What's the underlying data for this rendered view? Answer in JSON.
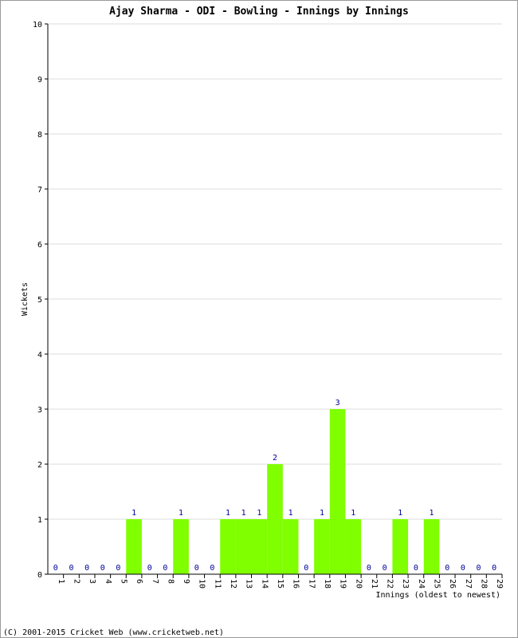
{
  "chart_data": {
    "type": "bar",
    "title": "Ajay Sharma - ODI - Bowling - Innings by Innings",
    "xlabel": "Innings (oldest to newest)",
    "ylabel": "Wickets",
    "ylim": [
      0,
      10
    ],
    "yticks": [
      0,
      1,
      2,
      3,
      4,
      5,
      6,
      7,
      8,
      9,
      10
    ],
    "grid": true,
    "categories": [
      "1",
      "2",
      "3",
      "4",
      "5",
      "6",
      "7",
      "8",
      "9",
      "10",
      "11",
      "12",
      "13",
      "14",
      "15",
      "16",
      "17",
      "18",
      "19",
      "20",
      "21",
      "22",
      "23",
      "24",
      "25",
      "26",
      "27",
      "28",
      "29"
    ],
    "values": [
      0,
      0,
      0,
      0,
      0,
      1,
      0,
      0,
      1,
      0,
      0,
      1,
      1,
      1,
      2,
      1,
      0,
      1,
      3,
      1,
      0,
      0,
      1,
      0,
      1,
      0,
      0,
      0,
      0
    ],
    "bar_color": "#80ff00",
    "label_color": "#000099"
  },
  "footer": "(C) 2001-2015 Cricket Web (www.cricketweb.net)"
}
